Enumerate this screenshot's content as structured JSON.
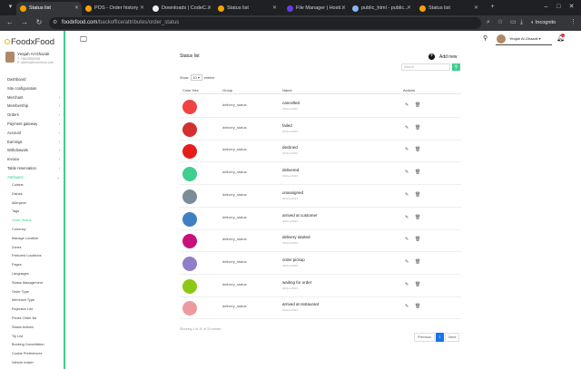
{
  "browser": {
    "tabs": [
      {
        "title": "Status list",
        "active": true,
        "color": "#f4a300"
      },
      {
        "title": "POS - Order history",
        "active": false,
        "color": "#f4a300"
      },
      {
        "title": "Downloads | CodeC...",
        "active": false,
        "color": "#eeeeee"
      },
      {
        "title": "Status list",
        "active": false,
        "color": "#f4a300"
      },
      {
        "title": "File Manager | Hosti...",
        "active": false,
        "color": "#673de6"
      },
      {
        "title": "public_html - public...",
        "active": false,
        "color": "#8ab4f8"
      },
      {
        "title": "Status list",
        "active": false,
        "color": "#f4a300"
      }
    ],
    "url_host": "foodxfood.com",
    "url_path": "/backoffice/attributes/order_status",
    "incognito_label": "Incognito"
  },
  "sidebar": {
    "brand": "FoodxFood",
    "profile": {
      "name": "Yeajah Al-Ghazali",
      "phone": "T: +8832852098",
      "email": "E: admin@foodxfood.com"
    },
    "menu": [
      {
        "label": "Dashboard",
        "chevron": false
      },
      {
        "label": "Site configuration",
        "chevron": false
      },
      {
        "label": "Merchant",
        "chevron": true
      },
      {
        "label": "Membership",
        "chevron": true
      },
      {
        "label": "Orders",
        "chevron": true
      },
      {
        "label": "Payment gateway",
        "chevron": true
      },
      {
        "label": "Account",
        "chevron": true
      },
      {
        "label": "Earnings",
        "chevron": true
      },
      {
        "label": "Withdrawals",
        "chevron": true
      },
      {
        "label": "Invoice",
        "chevron": true
      },
      {
        "label": "Table reservation",
        "chevron": true
      },
      {
        "label": "Attributes",
        "chevron": true,
        "active": true
      }
    ],
    "submenu": [
      {
        "label": "Cuisine"
      },
      {
        "label": "Dishes"
      },
      {
        "label": "Allergens"
      },
      {
        "label": "Tags"
      },
      {
        "label": "Order Status",
        "active": true
      },
      {
        "label": "Currency"
      },
      {
        "label": "Manage Location"
      },
      {
        "label": "Zones"
      },
      {
        "label": "Featured Locations"
      },
      {
        "label": "Pages"
      },
      {
        "label": "Languages"
      },
      {
        "label": "Status Management"
      },
      {
        "label": "Order Type"
      },
      {
        "label": "Merchant Type"
      },
      {
        "label": "Rejection List"
      },
      {
        "label": "Pause Order list"
      },
      {
        "label": "Status Actions"
      },
      {
        "label": "Tip List"
      },
      {
        "label": "Booking Cancellation"
      },
      {
        "label": "Cookie Preferences"
      },
      {
        "label": "Vehicle maker"
      }
    ]
  },
  "topnav": {
    "user_name": "Yeajah Al-Ghazali"
  },
  "page": {
    "title": "Status list",
    "add_new": "Add new",
    "search_placeholder": "Search",
    "show_label": "Show",
    "show_value": "10",
    "entries_label": "entries",
    "columns": [
      "Color Hex",
      "Group",
      "Name",
      "Actions"
    ],
    "rows": [
      {
        "color": "#ef4444",
        "group": "delivery_status",
        "name": "cancelled",
        "date": "30/Nov/2023"
      },
      {
        "color": "#d32f2f",
        "group": "delivery_status",
        "name": "failed",
        "date": "30/Nov/2023"
      },
      {
        "color": "#e51c1c",
        "group": "delivery_status",
        "name": "declined",
        "date": "30/Nov/2023"
      },
      {
        "color": "#3fcf8e",
        "group": "delivery_status",
        "name": "delivered",
        "date": "30/Nov/2023"
      },
      {
        "color": "#7b8d99",
        "group": "delivery_status",
        "name": "unassigned",
        "date": "30/Nov/2023"
      },
      {
        "color": "#3f7fc4",
        "group": "delivery_status",
        "name": "arrived at customer",
        "date": "30/Nov/2023"
      },
      {
        "color": "#c8107a",
        "group": "delivery_status",
        "name": "delivery started",
        "date": "30/Nov/2023"
      },
      {
        "color": "#8f7fc9",
        "group": "delivery_status",
        "name": "order pickup",
        "date": "30/Nov/2023"
      },
      {
        "color": "#8ec816",
        "group": "delivery_status",
        "name": "waiting for order",
        "date": "30/Nov/2023"
      },
      {
        "color": "#ec9aa0",
        "group": "delivery_status",
        "name": "arrived at restaurant",
        "date": "30/Nov/2023"
      }
    ],
    "footnote": "Showing 1 to 10 of 10 entries",
    "pager": {
      "prev": "Previous",
      "current": "1",
      "next": "Next"
    }
  }
}
